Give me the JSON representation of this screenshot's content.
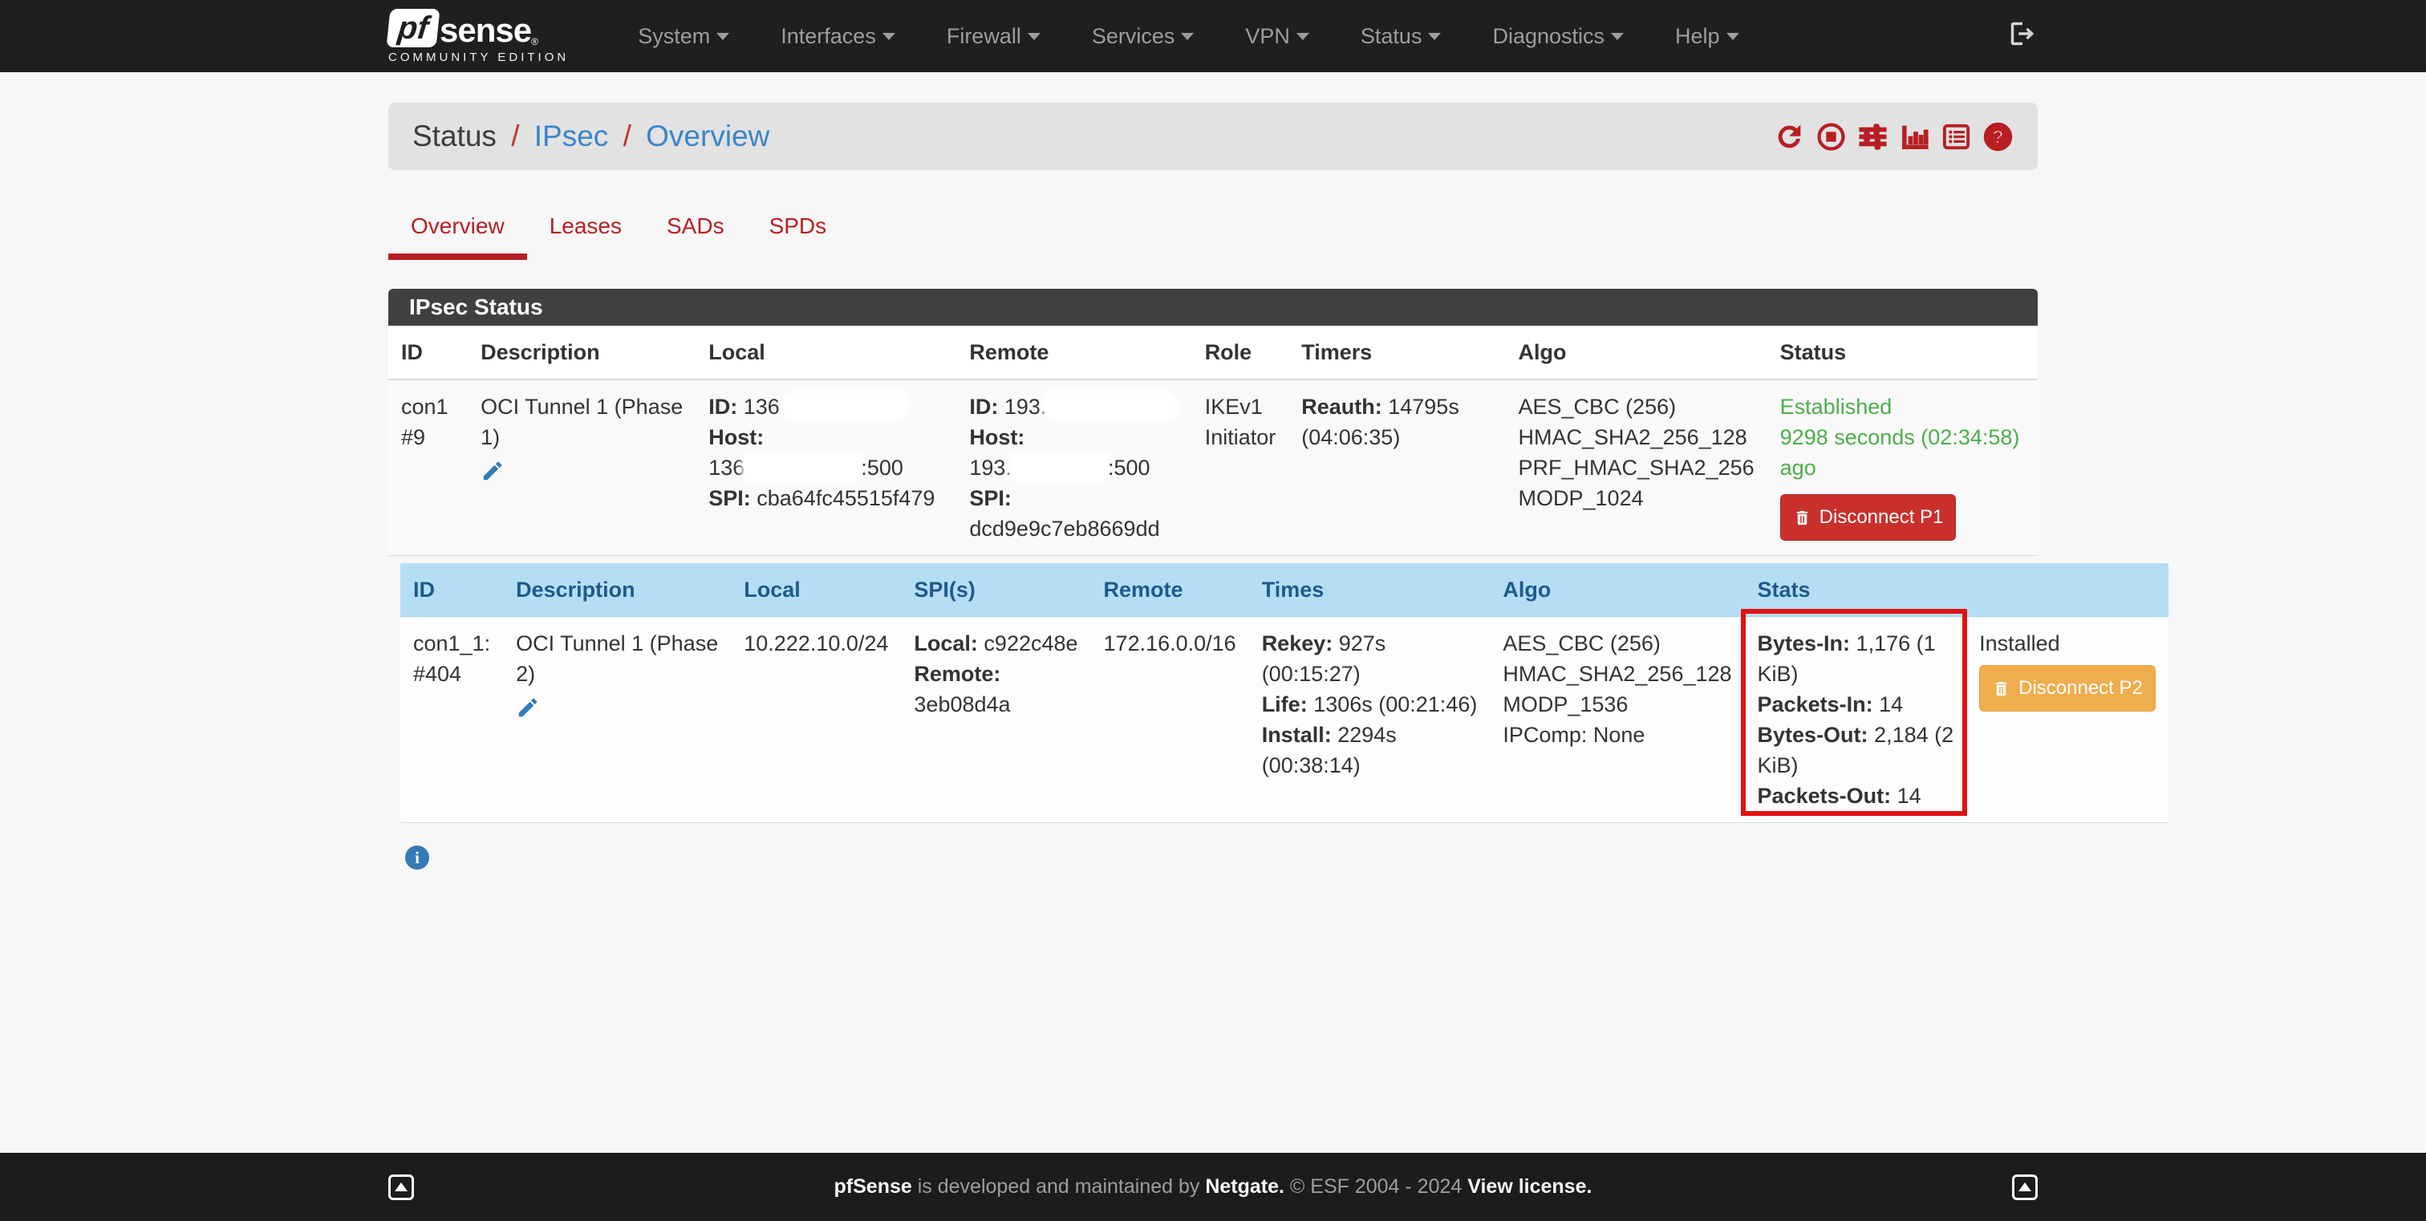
{
  "navbar": {
    "brand": {
      "pf": "pf",
      "sense": "sense",
      "reg": "®",
      "edition": "COMMUNITY EDITION"
    },
    "menus": [
      "System",
      "Interfaces",
      "Firewall",
      "Services",
      "VPN",
      "Status",
      "Diagnostics",
      "Help"
    ]
  },
  "breadcrumb": {
    "section": "Status",
    "sep": "/",
    "group": "IPsec",
    "page": "Overview"
  },
  "tabs": [
    {
      "label": "Overview"
    },
    {
      "label": "Leases"
    },
    {
      "label": "SADs"
    },
    {
      "label": "SPDs"
    }
  ],
  "panel": {
    "title": "IPsec Status"
  },
  "p1": {
    "headers": [
      "ID",
      "Description",
      "Local",
      "Remote",
      "Role",
      "Timers",
      "Algo",
      "Status"
    ],
    "row": {
      "id_line1": "con1",
      "id_line2": "#9",
      "desc_line1": "OCI Tunnel 1 (Phase",
      "desc_line2": "1)",
      "local": {
        "id_label": "ID:",
        "id_value": " 136",
        "host_label": "Host:",
        "host_value": "136",
        "host_port": ":500",
        "spi_label": "SPI:",
        "spi_value": " cba64fc45515f479"
      },
      "remote": {
        "id_label": "ID:",
        "id_value": " 193.",
        "host_label": "Host:",
        "host_value": "193.",
        "host_port": ":500",
        "spi_label": "SPI:",
        "spi_value": "dcd9e9c7eb8669dd"
      },
      "role_line1": "IKEv1",
      "role_line2": "Initiator",
      "timers": [
        {
          "label": "Reauth:",
          "text": " 14795s"
        },
        {
          "label": "",
          "text": "(04:06:35)"
        }
      ],
      "algo": [
        "AES_CBC (256)",
        "HMAC_SHA2_256_128",
        "PRF_HMAC_SHA2_256",
        "MODP_1024"
      ],
      "status": {
        "line1": "Established",
        "line2": "9298 seconds (02:34:58)",
        "line3": "ago",
        "button": "Disconnect P1"
      }
    }
  },
  "p2": {
    "headers": [
      "ID",
      "Description",
      "Local",
      "SPI(s)",
      "Remote",
      "Times",
      "Algo",
      "Stats",
      ""
    ],
    "row": {
      "id_line1": "con1_1:",
      "id_line2": "#404",
      "desc_line1": "OCI Tunnel 1 (Phase",
      "desc_line2": "2)",
      "local": "10.222.10.0/24",
      "spi": {
        "local_label": "Local:",
        "local_value": " c922c48e",
        "remote_label": "Remote:",
        "remote_value": "3eb08d4a"
      },
      "remote": "172.16.0.0/16",
      "times": [
        {
          "label": "Rekey:",
          "text": " 927s"
        },
        {
          "label": "",
          "text": "(00:15:27)"
        },
        {
          "label": "Life:",
          "text": " 1306s (00:21:46)"
        },
        {
          "label": "Install:",
          "text": " 2294s"
        },
        {
          "label": "",
          "text": "(00:38:14)"
        }
      ],
      "algo": [
        "AES_CBC (256)",
        "HMAC_SHA2_256_128",
        "MODP_1536",
        "IPComp: None"
      ],
      "stats": [
        {
          "label": "Bytes-In:",
          "text": " 1,176 (1"
        },
        {
          "label": "",
          "text": "KiB)"
        },
        {
          "label": "Packets-In:",
          "text": " 14"
        },
        {
          "label": "Bytes-Out:",
          "text": " 2,184 (2"
        },
        {
          "label": "",
          "text": "KiB)"
        },
        {
          "label": "Packets-Out:",
          "text": " 14"
        }
      ],
      "status": {
        "text": "Installed",
        "button": "Disconnect P2"
      }
    }
  },
  "footer": {
    "brand": "pfSense",
    "middle": " is developed and maintained by ",
    "netgate": "Netgate.",
    "copyright": " © ESF 2004 - 2024 ",
    "license": "View license."
  },
  "colors": {
    "accent_red": "#b71f23",
    "danger_red": "#c9302c",
    "warning_orange": "#f0ad4e",
    "success_green": "#4cae4c",
    "link_blue": "#3c85c9",
    "info_header_bg": "#b5def5",
    "annotation_red": "#df1212"
  }
}
